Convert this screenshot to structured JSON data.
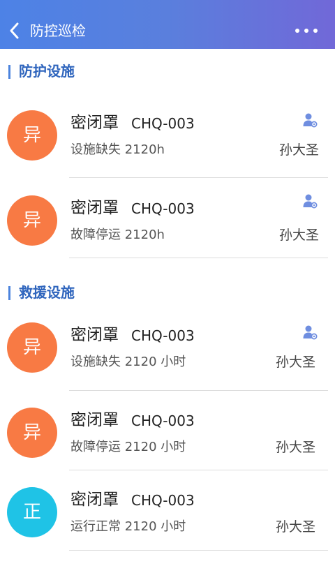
{
  "header": {
    "title": "防控巡检",
    "back_icon": "back-chevron-icon",
    "more_icon": "more-dots-icon"
  },
  "colors": {
    "abnormal": "#f87a44",
    "normal": "#1fc3e6",
    "accent": "#2f65bd",
    "icon": "#6f8ee0"
  },
  "sections": [
    {
      "title": "防护设施",
      "items": [
        {
          "badge": "异",
          "badge_type": "abnormal",
          "name": "密闭罩",
          "code": "CHQ-003",
          "status": "设施缺失 2120h",
          "person": "孙大圣",
          "has_user_icon": true
        },
        {
          "badge": "异",
          "badge_type": "abnormal",
          "name": "密闭罩",
          "code": "CHQ-003",
          "status": "故障停运 2120h",
          "person": "孙大圣",
          "has_user_icon": true
        }
      ]
    },
    {
      "title": "救援设施",
      "items": [
        {
          "badge": "异",
          "badge_type": "abnormal",
          "name": "密闭罩",
          "code": "CHQ-003",
          "status": "设施缺失 2120 小时",
          "person": "孙大圣",
          "has_user_icon": true
        },
        {
          "badge": "异",
          "badge_type": "abnormal",
          "name": "密闭罩",
          "code": "CHQ-003",
          "status": "故障停运 2120 小时",
          "person": "孙大圣",
          "has_user_icon": false
        },
        {
          "badge": "正",
          "badge_type": "normal",
          "name": "密闭罩",
          "code": "CHQ-003",
          "status": "运行正常 2120 小时",
          "person": "孙大圣",
          "has_user_icon": false
        }
      ]
    }
  ]
}
